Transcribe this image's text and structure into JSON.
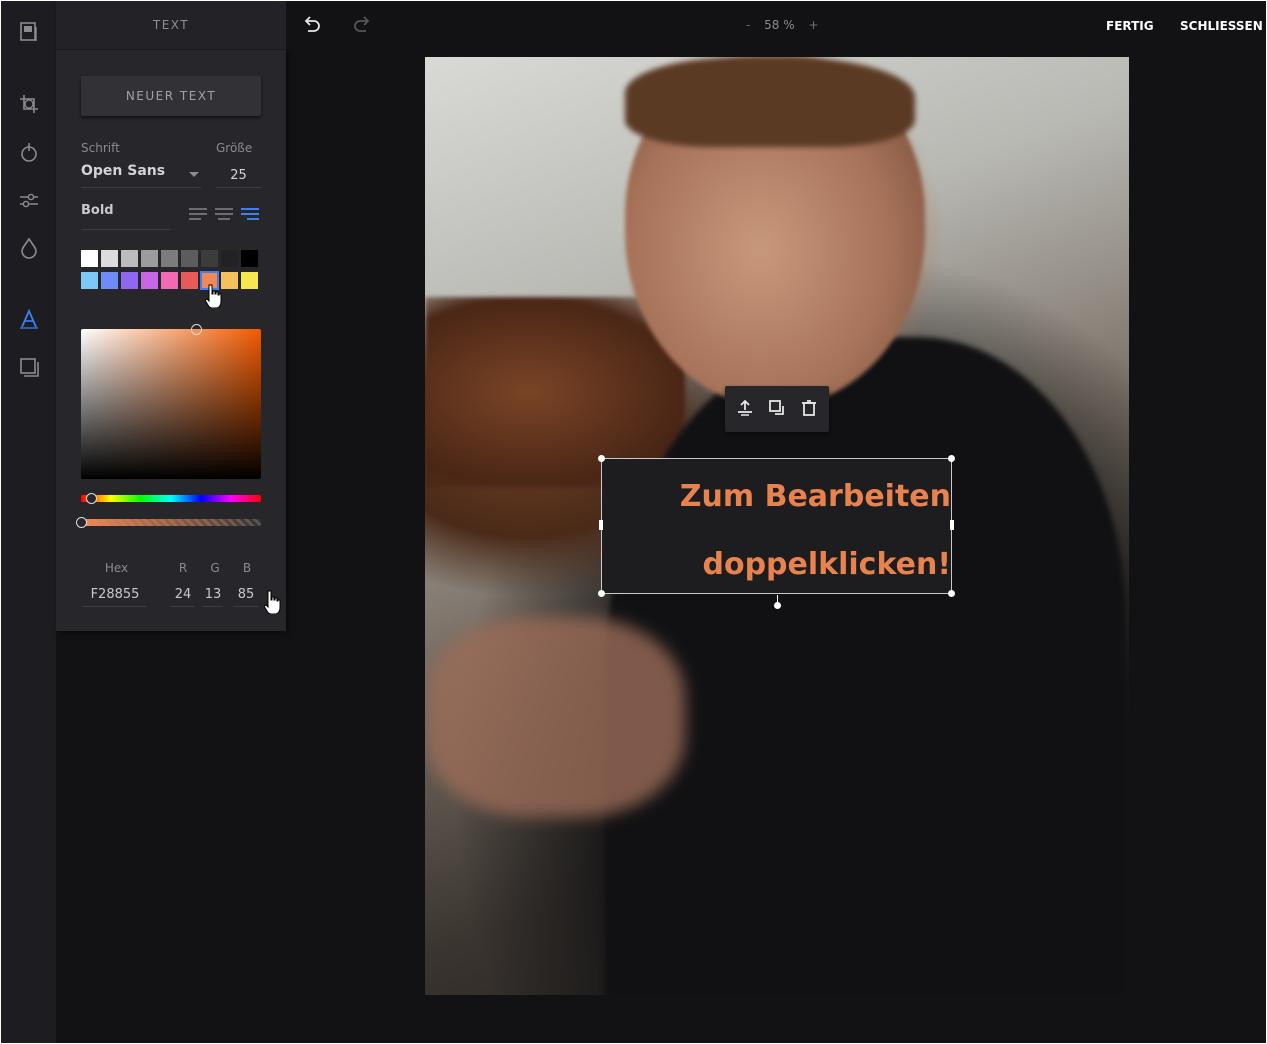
{
  "panel": {
    "title": "TEXT",
    "new_text_label": "NEUER TEXT",
    "font_label": "Schrift",
    "size_label": "Größe",
    "font_value": "Open Sans",
    "size_value": "25",
    "weight_value": "Bold",
    "alignment_active": "right",
    "swatch_colors": [
      "#ffffff",
      "#dcdcdc",
      "#bcbcbc",
      "#9c9c9c",
      "#7c7c7c",
      "#5c5c5c",
      "#3c3c3c",
      "#222222",
      "#000000",
      "#7cc9f7",
      "#6d8cf7",
      "#8f68f2",
      "#c767e6",
      "#f26ab4",
      "#e85a5a",
      "#f28855",
      "#f5c15c",
      "#f7e64d"
    ],
    "selected_swatch": "#f28855",
    "color_fields": {
      "hex_label": "Hex",
      "r_label": "R",
      "g_label": "G",
      "b_label": "B",
      "hex_value": "F28855",
      "r_value": "24",
      "g_value": "13",
      "b_value": "85"
    }
  },
  "topbar": {
    "zoom_minus": "-",
    "zoom_value": "58 %",
    "zoom_plus": "+",
    "done_label": "FERTIG",
    "close_label": "SCHLIESSEN"
  },
  "canvas": {
    "text_content": "Zum Bearbeiten\ndoppelklicken!",
    "text_color": "#e8834f"
  },
  "icons": {
    "rail": [
      "template-icon",
      "crop-icon",
      "filter-icon",
      "adjust-icon",
      "drop-icon",
      "text-icon",
      "frame-icon"
    ],
    "toolbar": [
      "bring-to-front-icon",
      "duplicate-icon",
      "delete-icon"
    ]
  }
}
